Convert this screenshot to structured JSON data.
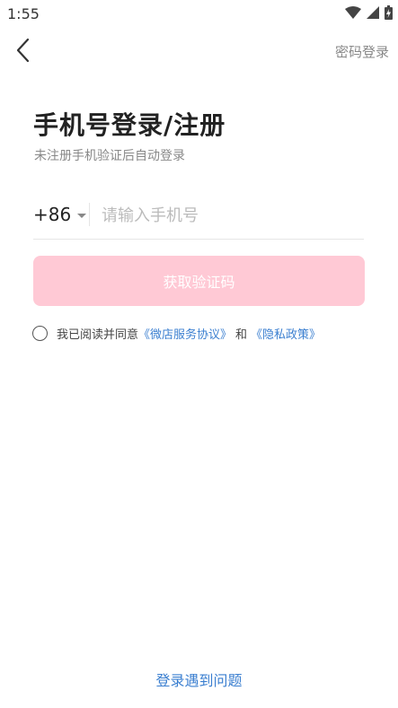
{
  "status_bar": {
    "time": "1:55"
  },
  "header": {
    "password_login": "密码登录"
  },
  "title": "手机号登录/注册",
  "subtitle": "未注册手机验证后自动登录",
  "phone": {
    "country_code": "+86",
    "placeholder": "请输入手机号",
    "value": ""
  },
  "get_code_button": "获取验证码",
  "agreement": {
    "prefix": "我已阅读并同意",
    "service_link": "《微店服务协议》",
    "and": "和",
    "privacy_link": "《隐私政策》"
  },
  "help_link": "登录遇到问题",
  "colors": {
    "accent_disabled": "#ffc9d5",
    "link": "#3b7fd0"
  }
}
